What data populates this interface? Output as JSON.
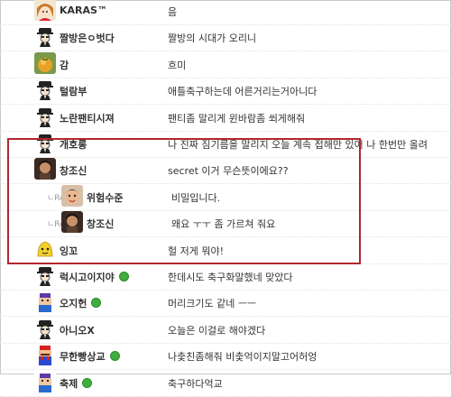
{
  "comments": [
    {
      "nick": "KARAS™",
      "msg": "음",
      "avatar": "anime-girl-avatar",
      "reply": false,
      "badge": false
    },
    {
      "nick": "짤방은ㅇ벗다",
      "msg": "짤방의 시대가 오리니",
      "avatar": "hat-man-avatar",
      "reply": false,
      "badge": false
    },
    {
      "nick": "감",
      "msg": "흐미",
      "avatar": "persimmon-avatar",
      "reply": false,
      "badge": false
    },
    {
      "nick": "털람부",
      "msg": "애틀축구하는데 어른거리는거아니다",
      "avatar": "hat-man-avatar",
      "reply": false,
      "badge": false
    },
    {
      "nick": "노란팬티시져",
      "msg": "팬티좀 말리게 윈바람좀 쐬게해줘",
      "avatar": "hat-man-avatar",
      "reply": false,
      "badge": false
    },
    {
      "nick": "개호롱",
      "msg": "나 진짜 짐기름을 말리지 오늘 계속 접해만 있어 나 한번만 올려",
      "avatar": "hat-man-avatar",
      "reply": false,
      "badge": false
    },
    {
      "nick": "창조신",
      "msg": "secret 이거 무슨뜻이에요??",
      "avatar": "photo-avatar",
      "reply": false,
      "badge": false
    },
    {
      "nick": "위험수준",
      "msg": "비밀입니다.",
      "avatar": "face-avatar",
      "reply": true,
      "badge": false
    },
    {
      "nick": "창조신",
      "msg": "왜요 ㅜㅜ 좀 가르쳐 줘요",
      "avatar": "photo-avatar",
      "reply": true,
      "badge": false
    },
    {
      "nick": "잉꼬",
      "msg": "헐 저게 뭐야!",
      "avatar": "yellow-character-avatar",
      "reply": false,
      "badge": false
    },
    {
      "nick": "럭시고이지야",
      "msg": "한데시도 축구화말했네 맞았다",
      "avatar": "hat-man-avatar",
      "reply": false,
      "badge": true
    },
    {
      "nick": "오지헌",
      "msg": "머리크기도 같네 ㅡㅡ",
      "avatar": "pixel-avatar",
      "reply": false,
      "badge": true
    },
    {
      "nick": "아니오X",
      "msg": "오늘은 이걸로 해야겠다",
      "avatar": "hat-man-avatar",
      "reply": false,
      "badge": false
    },
    {
      "nick": "무한빵상교",
      "msg": "나춫친좀해줘 비춫억이지말고어허엉",
      "avatar": "mario-avatar",
      "reply": false,
      "badge": true
    },
    {
      "nick": "축제",
      "msg": "축구하다억교",
      "avatar": "pixel-avatar",
      "reply": false,
      "badge": true
    }
  ],
  "reply_marker": "ㄴRe",
  "colors": {
    "highlight": "#b3262c",
    "online_badge": "#3fae3f"
  }
}
